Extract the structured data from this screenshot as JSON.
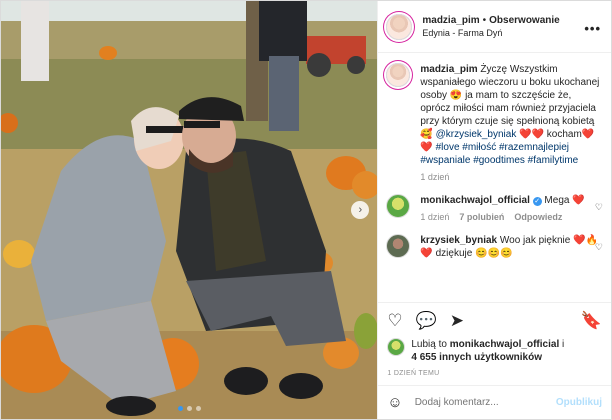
{
  "post": {
    "author": "madzia_pim",
    "separator": "•",
    "follow_label": "Obserwowanie",
    "location": "Edynia - Farma Dyń",
    "more_label": "•••"
  },
  "caption": {
    "author": "madzia_pim",
    "text1": "Życzę Wszystkim wspaniałego wieczoru u boku ukochanej osoby ",
    "emoji1": "😍",
    "text2": " ja mam to szczęście że, oprócz miłości mam również przyjaciela przy którym czuje się spełnioną kobietą ",
    "emoji2": "🥰",
    "mention": "@krzysiek_byniak",
    "hearts1": "❤️❤️",
    "text3": " kocham",
    "hearts2": "❤️❤️",
    "hashtags": "#love #miłość #razemnajlepiej #wspaniale #goodtimes #familytime",
    "time": "1 dzień"
  },
  "comments": [
    {
      "author": "monikachwajol_official",
      "verified_icon": "✓",
      "text": "Mega ",
      "emoji": "❤️",
      "time": "1 dzień",
      "likes": "7 polubień",
      "reply": "Odpowiedz"
    },
    {
      "author": "krzysiek_byniak",
      "text": "Woo jak pięknie ",
      "emoji": "❤️🔥❤️",
      "text2": " dziękuje ",
      "emoji2": "😊😊😊"
    }
  ],
  "likes": {
    "prefix": "Lubią to ",
    "user": "monikachwajol_official",
    "middle": " i",
    "count": "4 655 innych użytkowników"
  },
  "age_label": "1 DZIEŃ TEMU",
  "comment_box": {
    "placeholder": "Dodaj komentarz...",
    "publish_label": "Opublikuj"
  },
  "icons": {
    "heart": "♡",
    "comment": "💬",
    "share": "➤",
    "bookmark": "🔖",
    "smile": "☺",
    "chevron": "›"
  }
}
